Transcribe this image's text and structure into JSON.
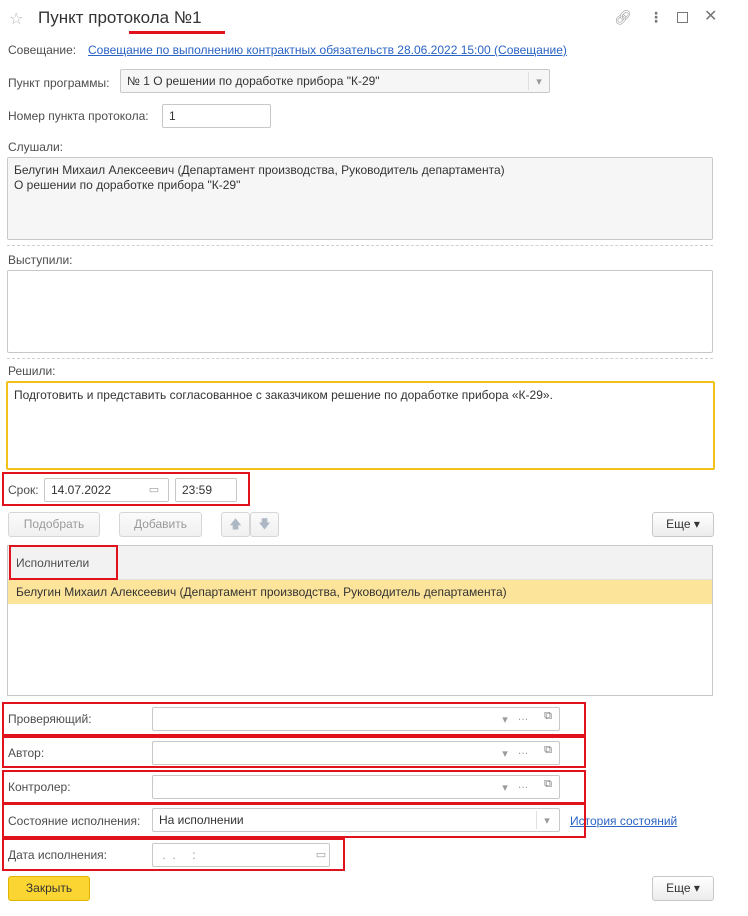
{
  "window": {
    "title": "Пункт протокола №1",
    "icons": {
      "star": "star-icon",
      "link": "link-icon",
      "more": "more-vertical-icon",
      "maximize": "maximize-icon",
      "close": "close-icon"
    }
  },
  "form": {
    "meeting_label": "Совещание:",
    "meeting_link": "Совещание по выполнению контрактных обязательств 28.06.2022 15:00 (Совещание)",
    "program_item_label": "Пункт программы:",
    "program_item_value": "№ 1 О решении по доработке прибора \"К-29\"",
    "protocol_number_label": "Номер пункта протокола:",
    "protocol_number_value": "1",
    "heard_label": "Слушали:",
    "heard_line1": "Белугин Михаил Алексеевич (Департамент производства, Руководитель департамента)",
    "heard_line2": "О решении по доработке прибора \"К-29\"",
    "spoke_label": "Выступили:",
    "spoke_value": "",
    "decided_label": "Решили:",
    "decided_value": "Подготовить и представить согласованное с заказчиком решение по доработке прибора «К-29».",
    "deadline_label": "Срок:",
    "deadline_date": "14.07.2022",
    "deadline_time": "23:59"
  },
  "toolbar": {
    "pick_label": "Подобрать",
    "add_label": "Добавить",
    "more_label": "Еще ▾"
  },
  "executors_table": {
    "header": "Исполнители",
    "rows": [
      "Белугин Михаил Алексеевич (Департамент производства, Руководитель департамента)"
    ]
  },
  "fields": {
    "reviewer_label": "Проверяющий:",
    "reviewer_value": "",
    "author_label": "Автор:",
    "author_value": "",
    "controller_label": "Контролер:",
    "controller_value": "",
    "status_label": "Состояние исполнения:",
    "status_value": "На исполнении",
    "status_history_link": "История состояний",
    "completion_date_label": "Дата исполнения:",
    "completion_date_placeholder": " .  .     :  "
  },
  "footer": {
    "close_label": "Закрыть",
    "more_label": "Еще ▾"
  },
  "colors": {
    "accent_yellow": "#fbd633",
    "selected_row": "#fce49a",
    "focus_border": "#f2c11a",
    "annotation_red": "#e0121b",
    "link_blue": "#2a64c4"
  }
}
